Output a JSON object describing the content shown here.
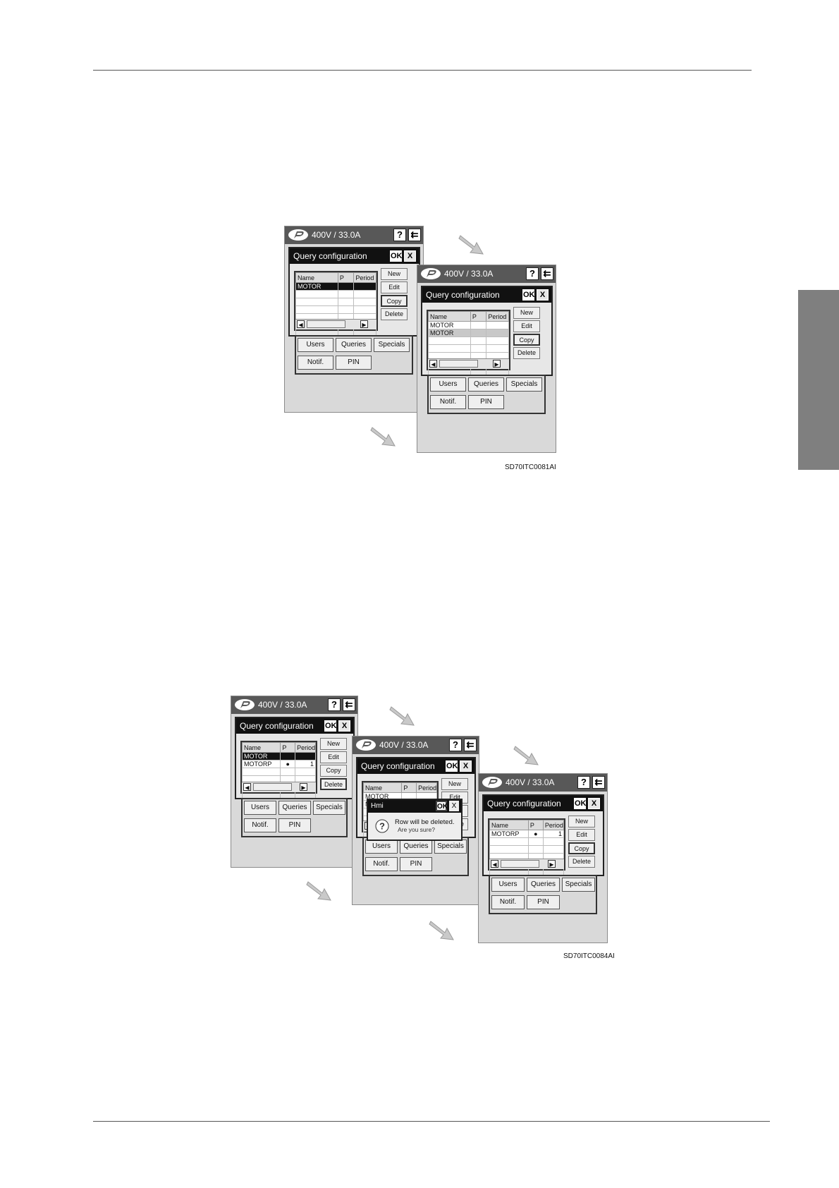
{
  "figures": [
    {
      "code": "SD70ITC0081AI",
      "screens": [
        {
          "status": "400V / 33.0A",
          "title": "Query configuration",
          "ok": "OK",
          "close": "X",
          "help": "?",
          "back": "⇇",
          "columns": [
            "Name",
            "P",
            "Period"
          ],
          "rows": [
            [
              "MOTOR",
              "",
              ""
            ],
            [
              "",
              "",
              ""
            ],
            [
              "",
              "",
              ""
            ],
            [
              "",
              "",
              ""
            ],
            [
              "",
              "",
              ""
            ],
            [
              "",
              "",
              ""
            ],
            [
              "",
              "",
              ""
            ],
            [
              "",
              "",
              ""
            ]
          ],
          "selected_row": 0,
          "buttons": [
            "New",
            "Edit",
            "Copy",
            "Delete"
          ],
          "active_button": "Copy",
          "panel_row1": [
            "Users",
            "Queries",
            "Specials"
          ],
          "panel_row2": [
            "Notif.",
            "PIN"
          ]
        },
        {
          "status": "400V / 33.0A",
          "title": "Query configuration",
          "ok": "OK",
          "close": "X",
          "help": "?",
          "back": "⇇",
          "columns": [
            "Name",
            "P",
            "Period"
          ],
          "rows": [
            [
              "MOTOR",
              "",
              ""
            ],
            [
              "MOTOR",
              "",
              ""
            ],
            [
              "",
              "",
              ""
            ],
            [
              "",
              "",
              ""
            ],
            [
              "",
              "",
              ""
            ],
            [
              "",
              "",
              ""
            ],
            [
              "",
              "",
              ""
            ]
          ],
          "highlight_row": 1,
          "buttons": [
            "New",
            "Edit",
            "Copy",
            "Delete"
          ],
          "active_button": "Copy",
          "panel_row1": [
            "Users",
            "Queries",
            "Specials"
          ],
          "panel_row2": [
            "Notif.",
            "PIN"
          ]
        }
      ]
    },
    {
      "code": "SD70ITC0084AI",
      "screens": [
        {
          "status": "400V / 33.0A",
          "title": "Query configuration",
          "ok": "OK",
          "close": "X",
          "help": "?",
          "back": "⇇",
          "columns": [
            "Name",
            "P",
            "Period"
          ],
          "rows": [
            [
              "MOTOR",
              "",
              ""
            ],
            [
              "MOTORP",
              "●",
              "1"
            ],
            [
              "",
              "",
              ""
            ],
            [
              "",
              "",
              ""
            ],
            [
              "",
              "",
              ""
            ],
            [
              "",
              "",
              ""
            ],
            [
              "",
              "",
              ""
            ]
          ],
          "selected_row": 0,
          "buttons": [
            "New",
            "Edit",
            "Copy",
            "Delete"
          ],
          "active_button": "Delete",
          "panel_row1": [
            "Users",
            "Queries",
            "Specials"
          ],
          "panel_row2": [
            "Notif.",
            "PIN"
          ]
        },
        {
          "status": "400V / 33.0A",
          "title": "Query configuration",
          "ok": "OK",
          "close": "X",
          "help": "?",
          "back": "⇇",
          "columns": [
            "Name",
            "P",
            "Period"
          ],
          "rows": [
            [
              "MOTOR",
              "",
              ""
            ],
            [
              "MOTORP",
              "●",
              "1"
            ],
            [
              "",
              "",
              ""
            ],
            [
              "",
              "",
              ""
            ],
            [
              "",
              "",
              ""
            ],
            [
              "",
              "",
              ""
            ],
            [
              "",
              "",
              ""
            ]
          ],
          "buttons": [
            "New",
            "Edit",
            "Copy",
            "Delete"
          ],
          "panel_row1": [
            "Users",
            "Queries",
            "Specials"
          ],
          "panel_row2": [
            "Notif.",
            "PIN"
          ],
          "message_box": {
            "title": "Hmi",
            "ok": "OK",
            "close": "X",
            "line1": "Row will be deleted.",
            "line2": "Are you sure?"
          }
        },
        {
          "status": "400V / 33.0A",
          "title": "Query configuration",
          "ok": "OK",
          "close": "X",
          "help": "?",
          "back": "⇇",
          "columns": [
            "Name",
            "P",
            "Period"
          ],
          "rows": [
            [
              "MOTORP",
              "●",
              "1"
            ],
            [
              "",
              "",
              ""
            ],
            [
              "",
              "",
              ""
            ],
            [
              "",
              "",
              ""
            ],
            [
              "",
              "",
              ""
            ],
            [
              "",
              "",
              ""
            ],
            [
              "",
              "",
              ""
            ]
          ],
          "buttons": [
            "New",
            "Edit",
            "Copy",
            "Delete"
          ],
          "active_button": "Copy",
          "panel_row1": [
            "Users",
            "Queries",
            "Specials"
          ],
          "panel_row2": [
            "Notif.",
            "PIN"
          ]
        }
      ]
    }
  ],
  "colors": {
    "titlebar": "#585858",
    "screen_bg": "#d9d9d9",
    "side_tab": "#7f7f7f"
  },
  "icons": [
    "logo-icon",
    "help-icon",
    "back-icon",
    "arrow-icon",
    "question-icon"
  ]
}
